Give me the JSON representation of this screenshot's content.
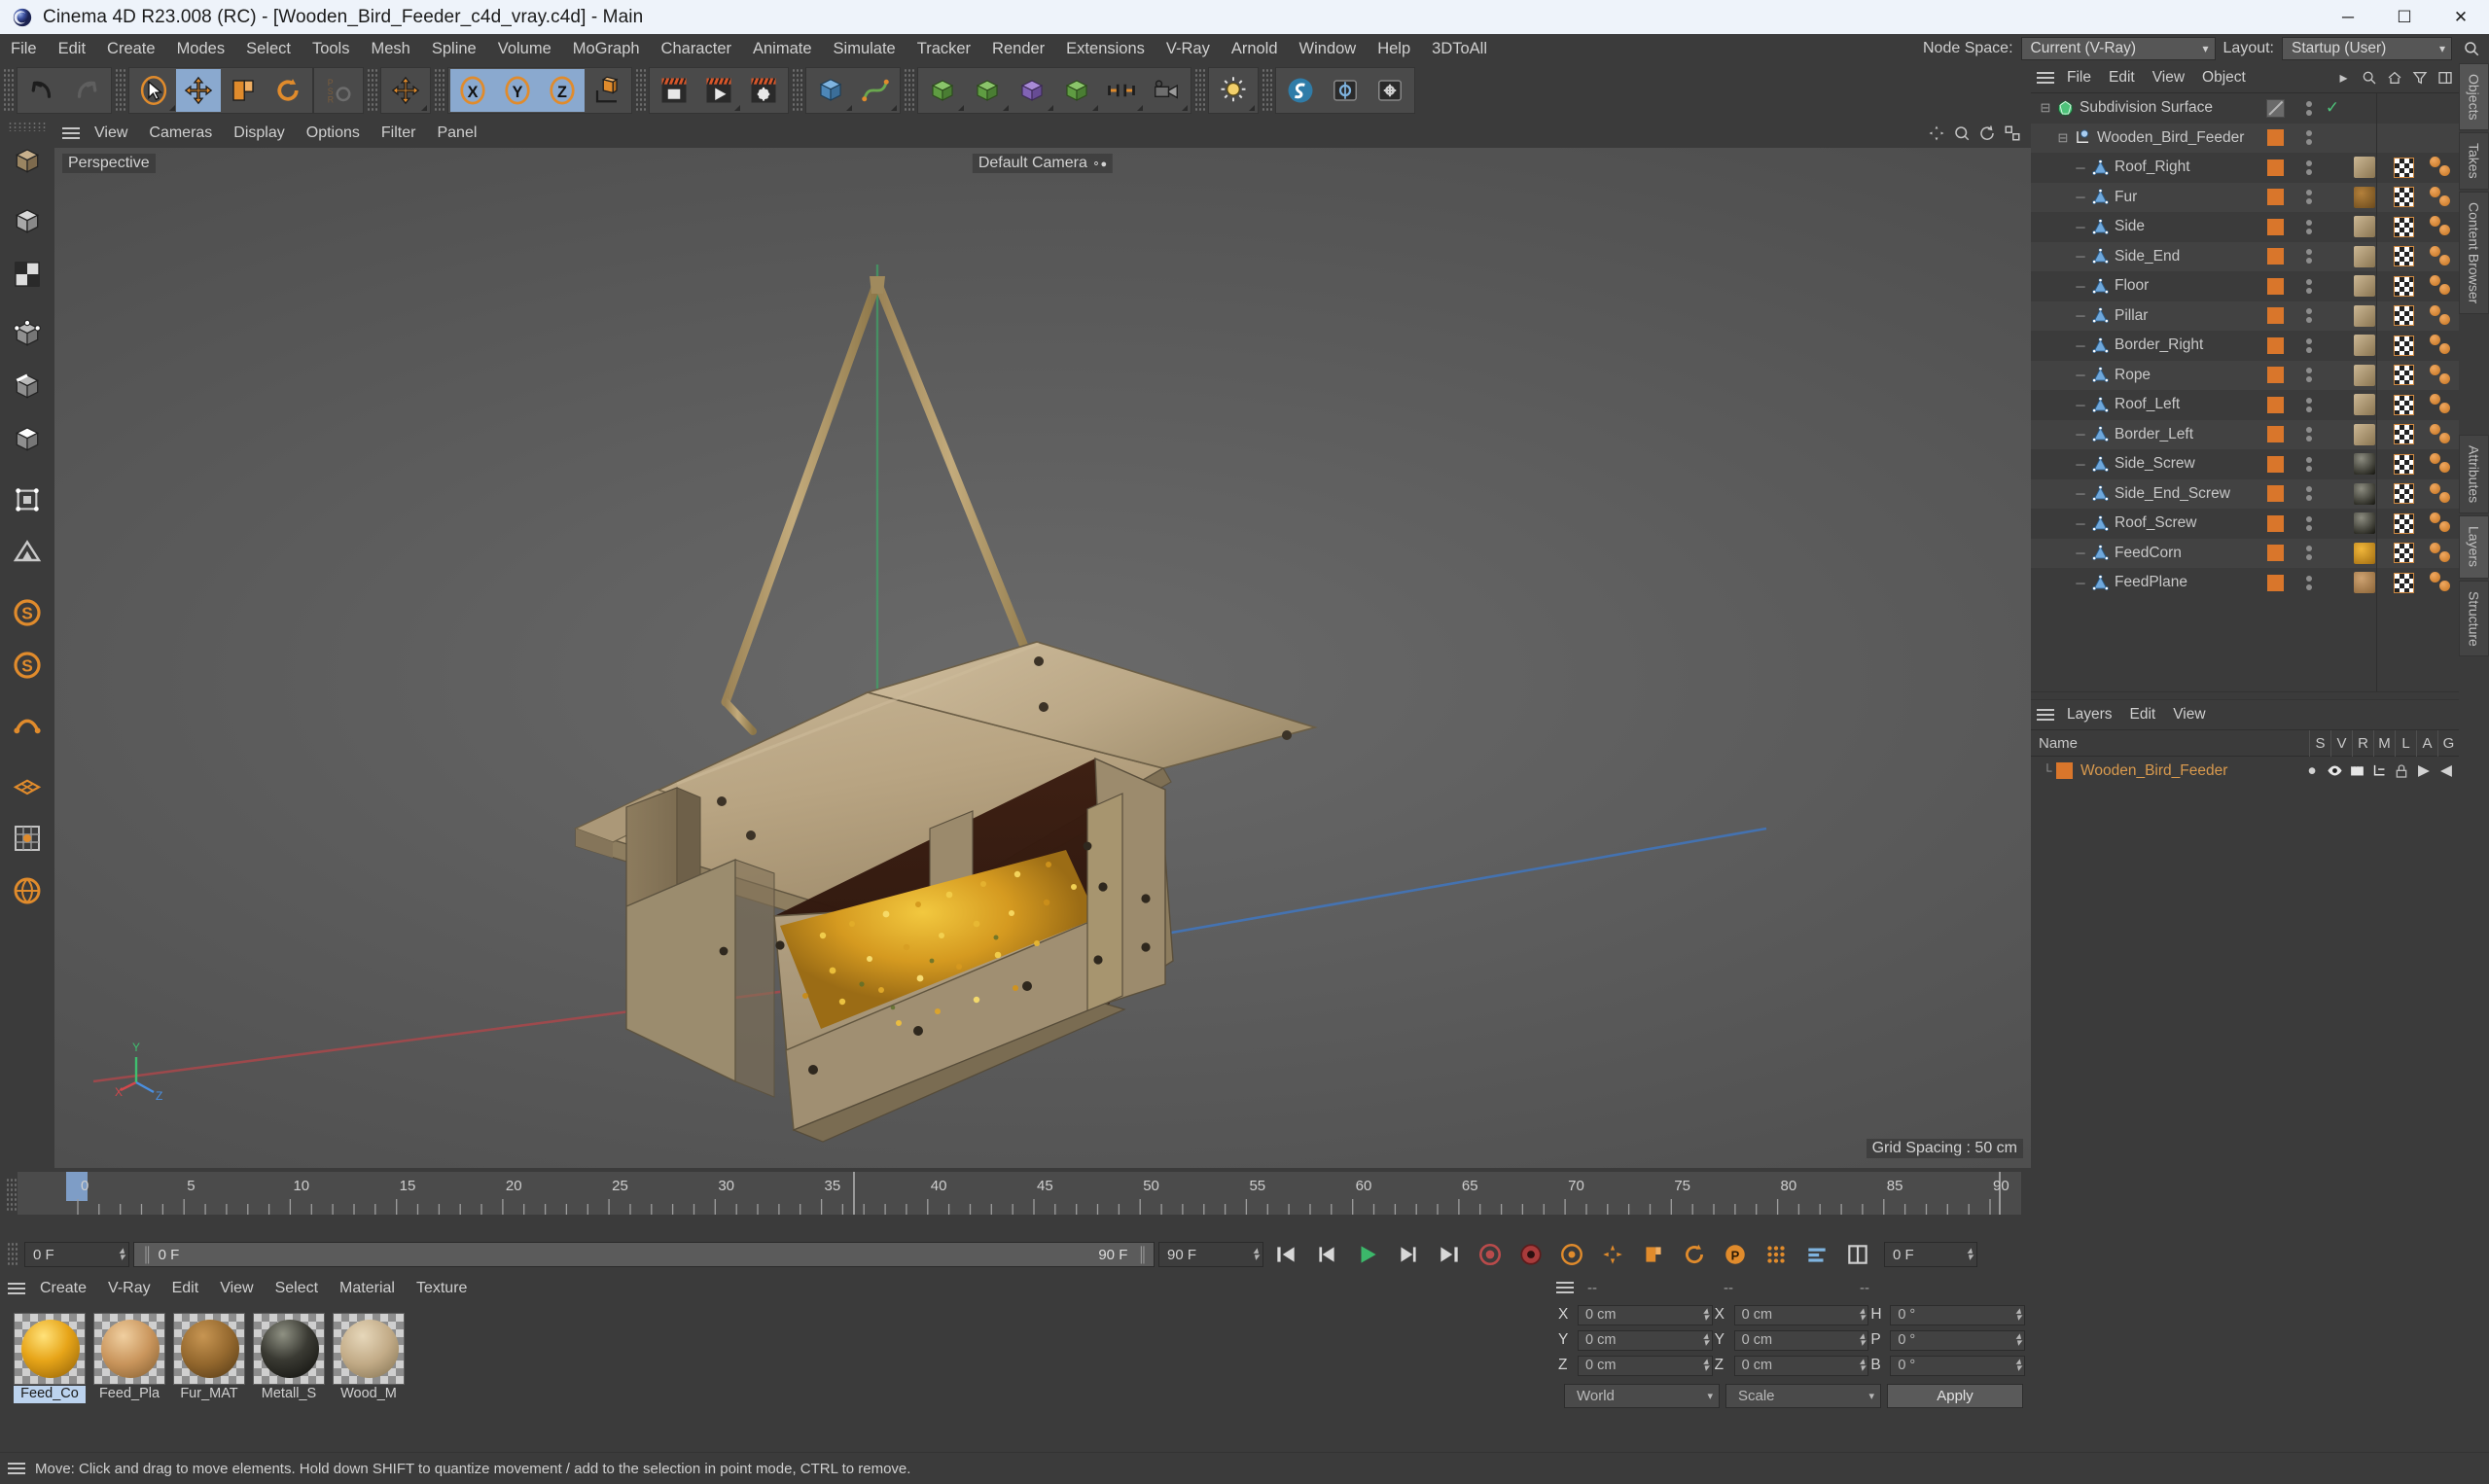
{
  "window": {
    "title": "Cinema 4D R23.008 (RC) - [Wooden_Bird_Feeder_c4d_vray.c4d] - Main",
    "minimize": "─",
    "maximize": "☐",
    "close": "✕"
  },
  "menubar": {
    "items": [
      "File",
      "Edit",
      "Create",
      "Modes",
      "Select",
      "Tools",
      "Mesh",
      "Spline",
      "Volume",
      "MoGraph",
      "Character",
      "Animate",
      "Simulate",
      "Tracker",
      "Render",
      "Extensions",
      "V-Ray",
      "Arnold",
      "Window",
      "Help",
      "3DToAll"
    ],
    "node_space_label": "Node Space:",
    "node_space_value": "Current (V-Ray)",
    "layout_label": "Layout:",
    "layout_value": "Startup (User)"
  },
  "viewport": {
    "menu": [
      "View",
      "Cameras",
      "Display",
      "Options",
      "Filter",
      "Panel"
    ],
    "perspective_label": "Perspective",
    "camera_label": "Default Camera",
    "grid_spacing": "Grid Spacing : 50 cm",
    "axis": {
      "x": "X",
      "y": "Y",
      "z": "Z"
    }
  },
  "object_manager": {
    "menu": [
      "File",
      "Edit",
      "View",
      "Object"
    ],
    "rows": [
      {
        "name": "Subdivision Surface",
        "depth": 0,
        "icon": "subdivision-surface-icon",
        "tags": "check"
      },
      {
        "name": "Wooden_Bird_Feeder",
        "depth": 1,
        "icon": "null-object-icon",
        "tags": "layer"
      },
      {
        "name": "Roof_Right",
        "depth": 2,
        "icon": "polygon-object-icon",
        "tags": "full",
        "mat": "wood-light"
      },
      {
        "name": "Fur",
        "depth": 2,
        "icon": "polygon-object-icon",
        "tags": "full",
        "mat": "fur"
      },
      {
        "name": "Side",
        "depth": 2,
        "icon": "polygon-object-icon",
        "tags": "full",
        "mat": "wood-light"
      },
      {
        "name": "Side_End",
        "depth": 2,
        "icon": "polygon-object-icon",
        "tags": "full",
        "mat": "wood-light"
      },
      {
        "name": "Floor",
        "depth": 2,
        "icon": "polygon-object-icon",
        "tags": "full",
        "mat": "wood-light"
      },
      {
        "name": "Pillar",
        "depth": 2,
        "icon": "polygon-object-icon",
        "tags": "full",
        "mat": "wood-light"
      },
      {
        "name": "Border_Right",
        "depth": 2,
        "icon": "polygon-object-icon",
        "tags": "full",
        "mat": "wood-light"
      },
      {
        "name": "Rope",
        "depth": 2,
        "icon": "polygon-object-icon",
        "tags": "full",
        "mat": "wood-light"
      },
      {
        "name": "Roof_Left",
        "depth": 2,
        "icon": "polygon-object-icon",
        "tags": "full",
        "mat": "wood-light"
      },
      {
        "name": "Border_Left",
        "depth": 2,
        "icon": "polygon-object-icon",
        "tags": "full",
        "mat": "wood-light"
      },
      {
        "name": "Side_Screw",
        "depth": 2,
        "icon": "polygon-object-icon",
        "tags": "full",
        "mat": "metal"
      },
      {
        "name": "Side_End_Screw",
        "depth": 2,
        "icon": "polygon-object-icon",
        "tags": "full",
        "mat": "metal"
      },
      {
        "name": "Roof_Screw",
        "depth": 2,
        "icon": "polygon-object-icon",
        "tags": "full",
        "mat": "metal"
      },
      {
        "name": "FeedCorn",
        "depth": 2,
        "icon": "polygon-object-icon",
        "tags": "full",
        "mat": "corn"
      },
      {
        "name": "FeedPlane",
        "depth": 2,
        "icon": "polygon-object-icon",
        "tags": "full",
        "mat": "feedplane"
      }
    ]
  },
  "layers_manager": {
    "menu": [
      "Layers",
      "Edit",
      "View"
    ],
    "columns": [
      "Name",
      "S",
      "V",
      "R",
      "M",
      "L",
      "A",
      "G"
    ],
    "rows": [
      {
        "name": "Wooden_Bird_Feeder",
        "color": "#d9762b"
      }
    ]
  },
  "right_tabs": [
    {
      "label": "Objects",
      "active": true
    },
    {
      "label": "Takes",
      "active": false
    },
    {
      "label": "Content Browser",
      "active": false
    },
    {
      "label": "Attributes",
      "active": false
    },
    {
      "label": "Layers",
      "active": true
    },
    {
      "label": "Structure",
      "active": false
    }
  ],
  "timeline": {
    "ticks": [
      "0",
      "5",
      "10",
      "15",
      "20",
      "25",
      "30",
      "35",
      "40",
      "45",
      "50",
      "55",
      "60",
      "65",
      "70",
      "75",
      "80",
      "85",
      "90"
    ],
    "current_frame": "0 F",
    "current_frame_secondary": "0 F",
    "end_frame": "90 F",
    "preview_end": "90 F",
    "frame_field_right": "0 F"
  },
  "material_manager": {
    "menu": [
      "Create",
      "V-Ray",
      "Edit",
      "View",
      "Select",
      "Material",
      "Texture"
    ],
    "materials": [
      {
        "name": "Feed_Co",
        "full": "Feed_Corn",
        "color": "#e7a519",
        "selected": true
      },
      {
        "name": "Feed_Pla",
        "full": "Feed_Plane",
        "color": "#c9955c",
        "selected": false
      },
      {
        "name": "Fur_MAT",
        "full": "Fur_MAT",
        "color": "#94682e",
        "selected": false
      },
      {
        "name": "Metall_S",
        "full": "Metall_Screw",
        "color": "#3a3a33",
        "selected": false
      },
      {
        "name": "Wood_M",
        "full": "Wood_MAT",
        "color": "#c2ab87",
        "selected": false
      }
    ]
  },
  "coordinates": {
    "header": [
      "--",
      "--",
      "--"
    ],
    "position": {
      "label_x": "X",
      "label_y": "Y",
      "label_z": "Z",
      "x": "0 cm",
      "y": "0 cm",
      "z": "0 cm"
    },
    "size": {
      "label_x": "X",
      "label_y": "Y",
      "label_z": "Z",
      "x": "0 cm",
      "y": "0 cm",
      "z": "0 cm"
    },
    "rotation": {
      "label_h": "H",
      "label_p": "P",
      "label_b": "B",
      "h": "0 °",
      "p": "0 °",
      "b": "0 °"
    },
    "coord_system": "World",
    "transform_mode": "Scale",
    "apply_label": "Apply"
  },
  "statusbar": {
    "message": "Move: Click and drag to move elements. Hold down SHIFT to quantize movement / add to the selection in point mode, CTRL to remove."
  },
  "colors": {
    "accent_orange": "#d9762b",
    "panel_bg": "#3b3b3b",
    "toolbar_active": "#8aa9cf",
    "text": "#cfcfcf",
    "title_bar": "#eef3fa"
  }
}
